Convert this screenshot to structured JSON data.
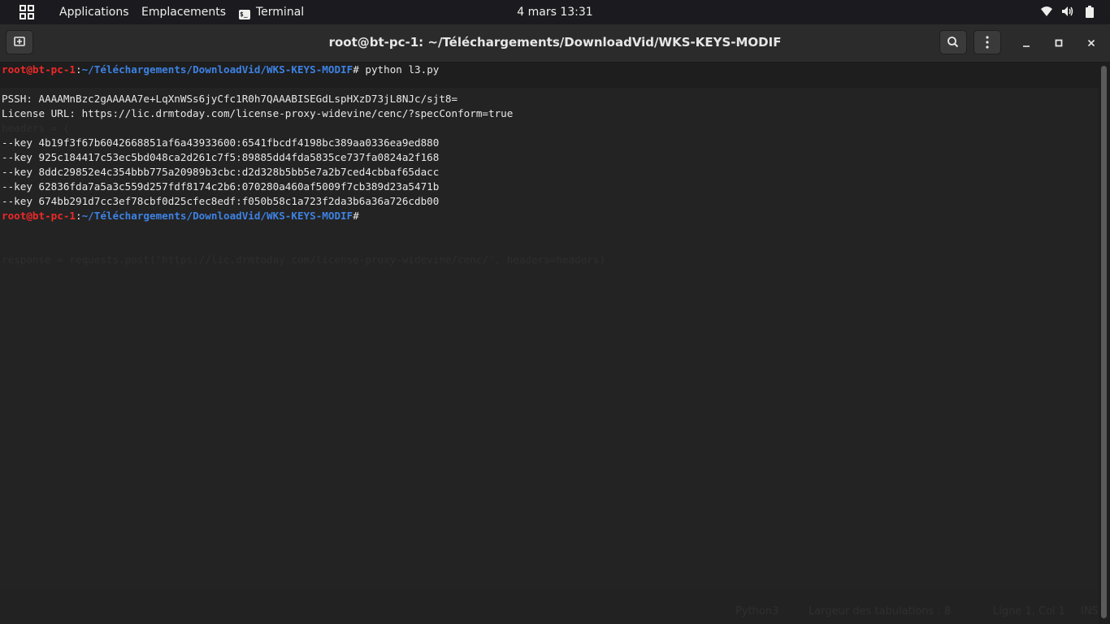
{
  "topbar": {
    "applications": "Applications",
    "places": "Emplacements",
    "app_name": "Terminal",
    "app_icon": "terminal-icon",
    "clock": "4 mars  13:31",
    "tray_icons": [
      "wifi-icon",
      "volume-icon",
      "battery-icon"
    ]
  },
  "headerbar": {
    "title": "root@bt-pc-1: ~/Téléchargements/DownloadVid/WKS-KEYS-MODIF",
    "icons": [
      "new-tab-icon",
      "search-icon",
      "menu-icon",
      "minimize-icon",
      "maximize-icon",
      "close-icon"
    ]
  },
  "terminal": {
    "prompt_user": "root@bt-pc-1",
    "prompt_sep": ":",
    "prompt_path": "~/Téléchargements/DownloadVid/WKS-KEYS-MODIF",
    "prompt_char": "#",
    "command": " python l3.py",
    "output": [
      "PSSH: AAAAMnBzc2gAAAAA7e+LqXnWSs6jyCfc1R0h7QAAABISEGdLspHXzD73jL8NJc/sjt8=",
      "License URL: https://lic.drmtoday.com/license-proxy-widevine/cenc/?specConform=true",
      "--key 4b19f3f67b6042668851af6a43933600:6541fbcdf4198bc389aa0336ea9ed880",
      "--key 925c184417c53ec5bd048ca2d261c7f5:89885dd4fda5835ce737fa0824a2f168",
      "--key 8ddc29852e4c354bbb775a20989b3cbc:d2d328b5bb5e7a2b7ced4cbbaf65dacc",
      "--key 62836fda7a5a3c559d257fdf8174c2b6:070280a460af5009f7cb389d23a5471b",
      "--key 674bb291d7cc3ef78cbf0d25cfec8edf:f050b58c1a723f2da3b6a36a726cdb00"
    ],
    "ghost_lines": [
      "headers = {",
      "response = requests.post('https://lic.drmtoday.com/license-proxy-widevine/cenc/', headers=headers)"
    ]
  },
  "ghost_statusbar": {
    "language": "Python3",
    "tab_width": "Largeur des tabulations : 8",
    "position": "Ligne 1, Col 1",
    "mode": "INS"
  }
}
